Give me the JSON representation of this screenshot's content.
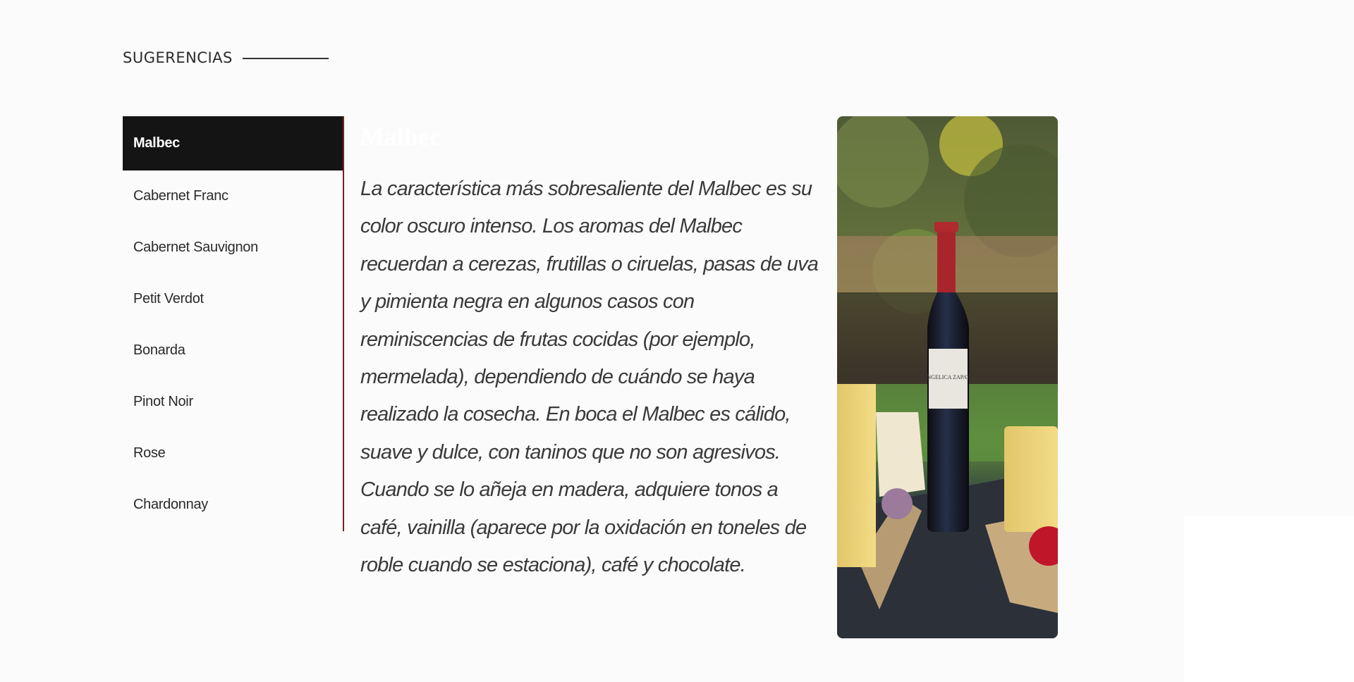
{
  "section": {
    "title": "SUGERENCIAS"
  },
  "tabs": [
    {
      "label": "Malbec",
      "active": true
    },
    {
      "label": "Cabernet Franc",
      "active": false
    },
    {
      "label": "Cabernet Sauvignon",
      "active": false
    },
    {
      "label": "Petit Verdot",
      "active": false
    },
    {
      "label": "Bonarda",
      "active": false
    },
    {
      "label": "Pinot Noir",
      "active": false
    },
    {
      "label": "Rose",
      "active": false
    },
    {
      "label": "Chardonnay",
      "active": false
    }
  ],
  "content": {
    "title": "Malbec",
    "description": "La característica más sobresaliente del Malbec es su color oscuro intenso. Los aromas del Malbec recuerdan a cerezas, frutillas o ciruelas, pasas de uva y pimienta negra en algunos casos con reminiscencias de frutas cocidas (por ejemplo, mermelada), dependiendo de cuándo se haya realizado la cosecha. En boca el Malbec es cálido, suave y dulce, con taninos que no son agresivos. Cuando se lo añeja en madera, adquiere tonos a café, vainilla (aparece por la oxidación en toneles de roble cuando se estaciona), café y chocolate."
  },
  "photo": {
    "label_text": "ANGELICA ZAPATA"
  },
  "colors": {
    "active_tab_bg": "#141414",
    "divider": "#7a1f22",
    "page_bg": "#fcfbfc"
  }
}
